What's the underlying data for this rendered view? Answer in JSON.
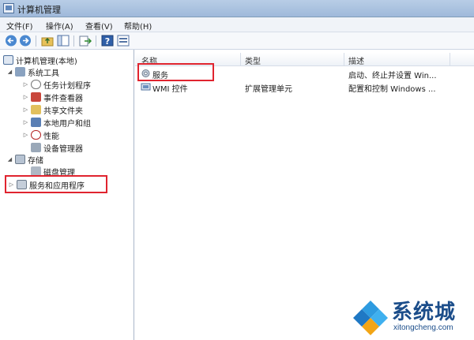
{
  "window": {
    "title": "计算机管理",
    "title_icon": "computer-management-icon"
  },
  "menu": {
    "items": [
      "文件(F)",
      "操作(A)",
      "查看(V)",
      "帮助(H)"
    ]
  },
  "toolbar": {
    "buttons": [
      "back-arrow-icon",
      "forward-arrow-icon",
      "up-folder-icon",
      "show-hide-tree-icon",
      "export-list-icon",
      "help-icon",
      "properties-icon"
    ]
  },
  "tree": {
    "root": "计算机管理(本地)",
    "system_tools": "系统工具",
    "task_scheduler": "任务计划程序",
    "event_viewer": "事件查看器",
    "shared_folders": "共享文件夹",
    "local_users": "本地用户和组",
    "performance": "性能",
    "device_manager": "设备管理器",
    "storage": "存储",
    "disk_management": "磁盘管理",
    "services_apps": "服务和应用程序"
  },
  "list": {
    "columns": [
      "名称",
      "类型",
      "描述"
    ],
    "rows": [
      {
        "name": "服务",
        "type": "",
        "desc": "启动、终止并设置 Win..."
      },
      {
        "name": "WMI 控件",
        "type": "扩展管理单元",
        "desc": "配置和控制 Windows ..."
      }
    ]
  },
  "watermark": {
    "title": "系统城",
    "url": "xitongcheng.com"
  },
  "colors": {
    "highlight": "#e0242f",
    "accent": "#1b4d8a",
    "titlebar": "#9fb9da"
  }
}
